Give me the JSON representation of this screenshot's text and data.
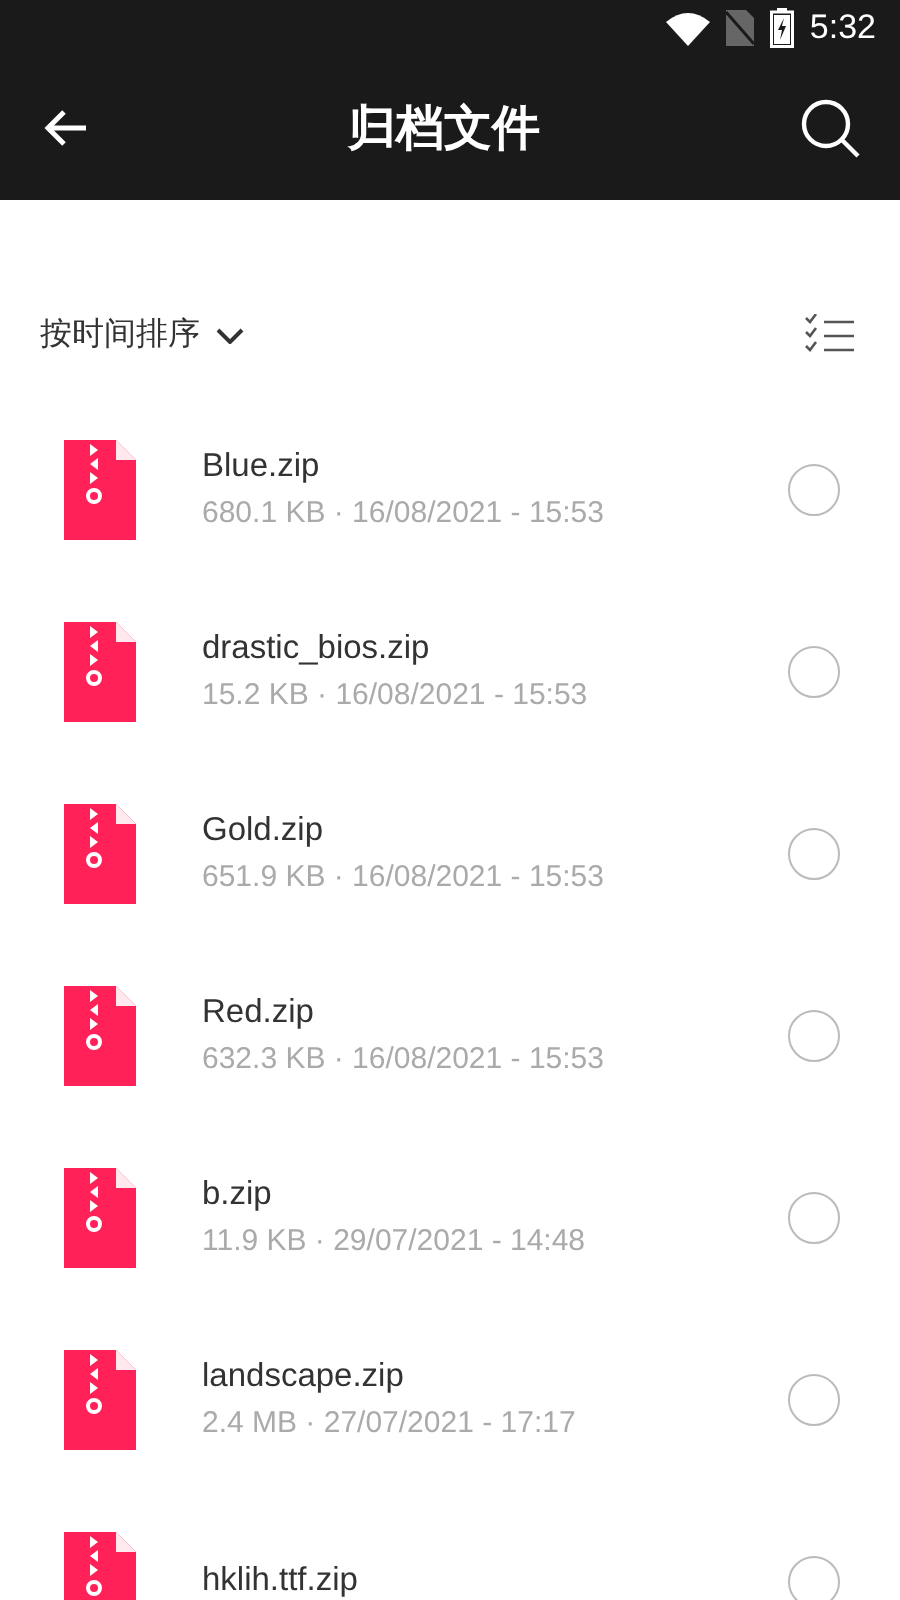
{
  "status_bar": {
    "time": "5:32"
  },
  "app_bar": {
    "title": "归档文件"
  },
  "sort": {
    "label": "按时间排序"
  },
  "files": [
    {
      "name": "Blue.zip",
      "details": "680.1 KB · 16/08/2021 - 15:53",
      "selected": false
    },
    {
      "name": "drastic_bios.zip",
      "details": "15.2 KB · 16/08/2021 - 15:53",
      "selected": false
    },
    {
      "name": "Gold.zip",
      "details": "651.9 KB · 16/08/2021 - 15:53",
      "selected": false
    },
    {
      "name": "Red.zip",
      "details": "632.3 KB · 16/08/2021 - 15:53",
      "selected": false
    },
    {
      "name": "b.zip",
      "details": "11.9 KB · 29/07/2021 - 14:48",
      "selected": false
    },
    {
      "name": "landscape.zip",
      "details": "2.4 MB · 27/07/2021 - 17:17",
      "selected": false
    },
    {
      "name": "hklih.ttf.zip",
      "selected": false
    }
  ]
}
